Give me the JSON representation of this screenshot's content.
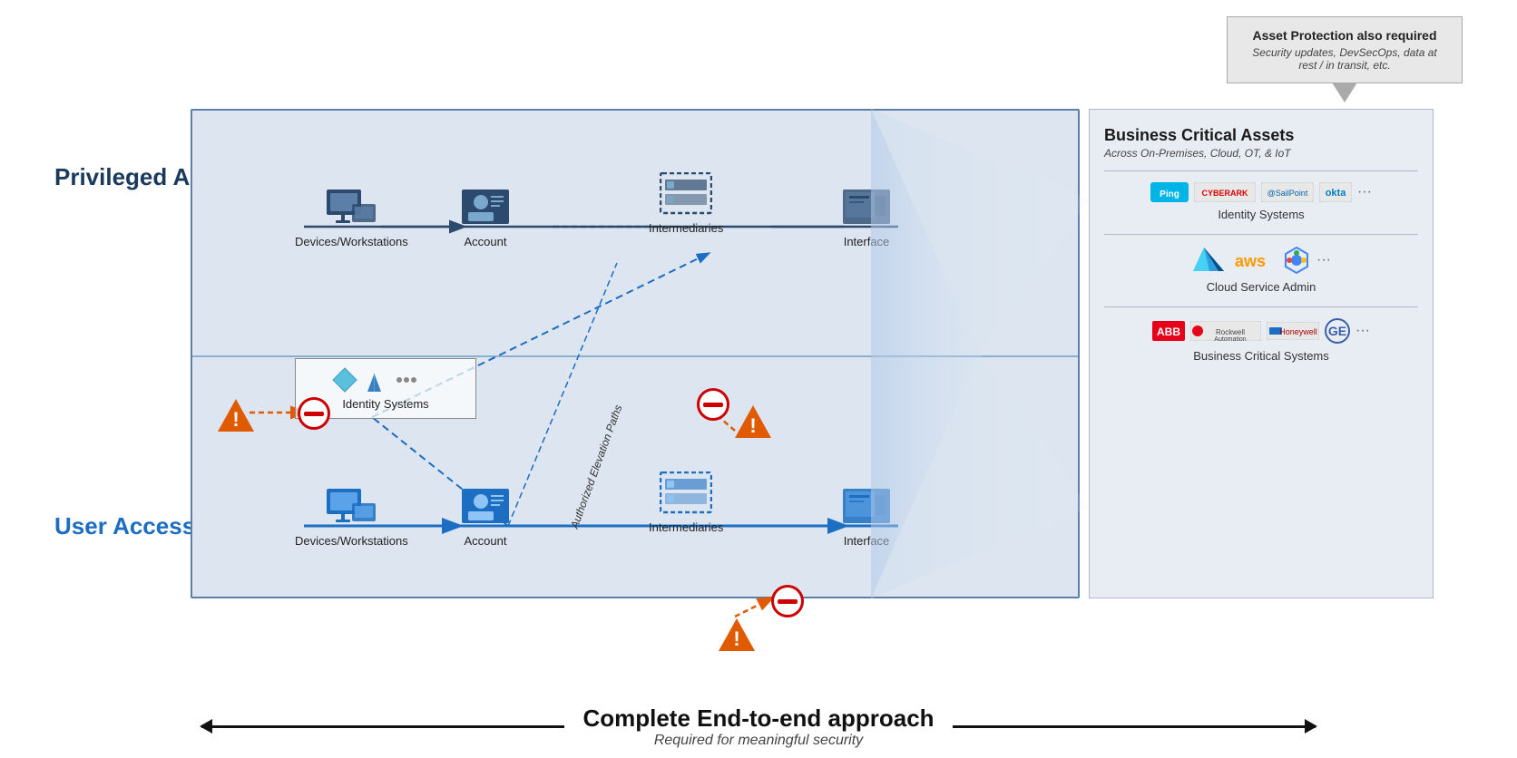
{
  "callout": {
    "title": "Asset Protection also required",
    "text": "Security updates, DevSecOps, data at rest / in transit, etc."
  },
  "privileged": {
    "label": "Privileged Access"
  },
  "user": {
    "label": "User Access"
  },
  "nodes": {
    "priv_devices_label": "Devices/Workstations",
    "priv_account_label": "Account",
    "priv_intermediaries_label": "Intermediaries",
    "priv_interface_label": "Interface",
    "user_devices_label": "Devices/Workstations",
    "user_account_label": "Account",
    "user_intermediaries_label": "Intermediaries",
    "user_interface_label": "Interface",
    "identity_systems_label": "Identity Systems"
  },
  "elevation": {
    "label": "Authorized Elevation Paths"
  },
  "bca": {
    "title": "Business Critical Assets",
    "subtitle": "Across On-Premises, Cloud, OT, & IoT",
    "identity_section": "Identity Systems",
    "cloud_section": "Cloud Service Admin",
    "ot_section": "Business Critical Systems"
  },
  "bottom": {
    "title": "Complete End-to-end approach",
    "subtitle": "Required for meaningful security"
  },
  "colors": {
    "dark_blue": "#1a3a5c",
    "mid_blue": "#1b6ec2",
    "light_blue": "#dde6f0",
    "orange": "#e05a00",
    "red": "#c00000",
    "node_dark": "#2c4a6e",
    "node_bright": "#1b6ec2"
  }
}
